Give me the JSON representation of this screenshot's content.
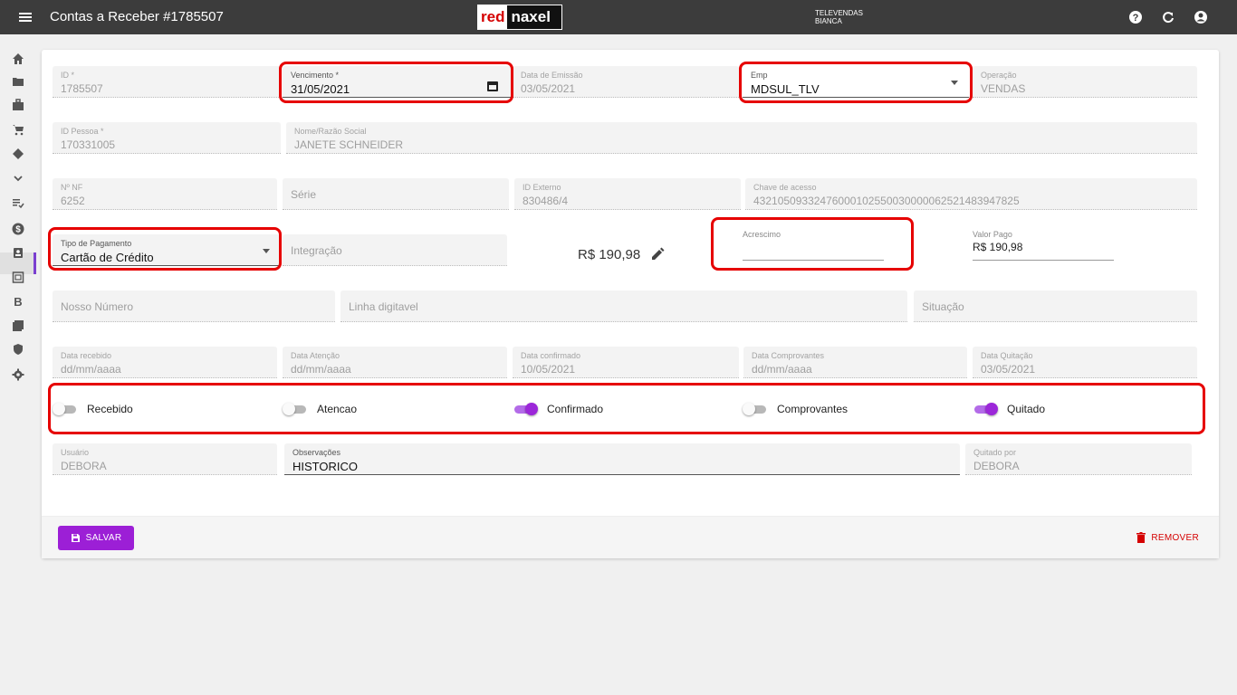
{
  "header": {
    "title": "Contas a Receber #1785507",
    "logo_red": "red",
    "logo_dark": "naxel",
    "user_line1": "TELEVENDAS",
    "user_line2": "BIANCA"
  },
  "sidebar": {
    "items": [
      "home-icon",
      "folder-icon",
      "briefcase-icon",
      "cart-icon",
      "directions-icon",
      "chevron-down-icon",
      "list-check-icon",
      "dollar-icon",
      "contacts-icon",
      "calendar-icon",
      "b-icon",
      "photos-icon",
      "shield-icon",
      "settings-icon"
    ],
    "b_label": "B",
    "active_item": "dollar-icon"
  },
  "form": {
    "id": {
      "label": "ID *",
      "value": "1785507"
    },
    "vencimento": {
      "label": "Vencimento *",
      "value": "31/05/2021"
    },
    "data_emissao": {
      "label": "Data de Emissão",
      "value": "03/05/2021"
    },
    "emp": {
      "label": "Emp",
      "value": "MDSUL_TLV"
    },
    "operacao": {
      "label": "Operação",
      "value": "VENDAS"
    },
    "id_pessoa": {
      "label": "ID Pessoa *",
      "value": "170331005"
    },
    "nome": {
      "label": "Nome/Razão Social",
      "value": "JANETE SCHNEIDER"
    },
    "nf": {
      "label": "Nº NF",
      "value": "6252"
    },
    "serie": {
      "placeholder": "Série"
    },
    "id_externo": {
      "label": "ID Externo",
      "value": "830486/4"
    },
    "chave": {
      "label": "Chave de acesso",
      "value": "43210509332476000102550030000062521483947825"
    },
    "tipo_pagamento": {
      "label": "Tipo de Pagamento",
      "value": "Cartão de Crédito"
    },
    "integracao": {
      "placeholder": "Integração"
    },
    "total": "R$ 190,98",
    "acrescimo": {
      "label": "Acrescimo",
      "value": ""
    },
    "valor_pago": {
      "label": "Valor Pago",
      "value": "R$ 190,98"
    },
    "nosso_numero": {
      "placeholder": "Nosso Número"
    },
    "linha_digitavel": {
      "placeholder": "Linha digitavel"
    },
    "situacao": {
      "placeholder": "Situação"
    },
    "data_recebido": {
      "label": "Data recebido",
      "value": "dd/mm/aaaa"
    },
    "data_atencao": {
      "label": "Data Atenção",
      "value": "dd/mm/aaaa"
    },
    "data_confirmado": {
      "label": "Data confirmado",
      "value": "10/05/2021"
    },
    "data_comprovantes": {
      "label": "Data Comprovantes",
      "value": "dd/mm/aaaa"
    },
    "data_quitacao": {
      "label": "Data Quitação",
      "value": "03/05/2021"
    },
    "usuario": {
      "label": "Usuário",
      "value": "DEBORA"
    },
    "observacoes": {
      "label": "Observações",
      "value": "HISTORICO"
    },
    "quitado_por": {
      "label": "Quitado por",
      "value": "DEBORA"
    }
  },
  "toggles": [
    {
      "label": "Recebido",
      "on": false
    },
    {
      "label": "Atencao",
      "on": false
    },
    {
      "label": "Confirmado",
      "on": true
    },
    {
      "label": "Comprovantes",
      "on": false
    },
    {
      "label": "Quitado",
      "on": true
    }
  ],
  "footer": {
    "save_label": "SALVAR",
    "remove_label": "REMOVER"
  },
  "colors": {
    "accent": "#9c1fd6",
    "highlight": "#e60000",
    "topbar": "#3c3c3c",
    "danger": "#d50000"
  }
}
